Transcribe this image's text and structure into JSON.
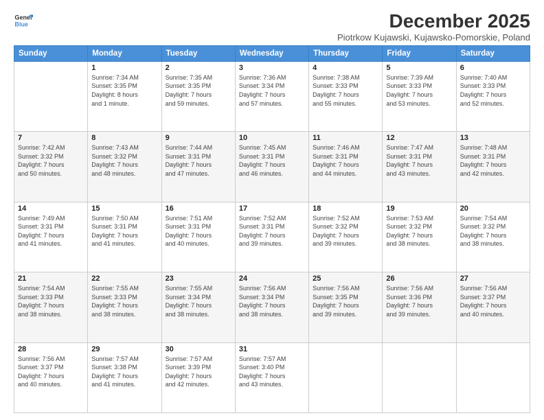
{
  "logo": {
    "line1": "General",
    "line2": "Blue"
  },
  "header": {
    "title": "December 2025",
    "subtitle": "Piotrkow Kujawski, Kujawsko-Pomorskie, Poland"
  },
  "weekdays": [
    "Sunday",
    "Monday",
    "Tuesday",
    "Wednesday",
    "Thursday",
    "Friday",
    "Saturday"
  ],
  "weeks": [
    [
      {
        "day": "",
        "info": ""
      },
      {
        "day": "1",
        "info": "Sunrise: 7:34 AM\nSunset: 3:35 PM\nDaylight: 8 hours\nand 1 minute."
      },
      {
        "day": "2",
        "info": "Sunrise: 7:35 AM\nSunset: 3:35 PM\nDaylight: 7 hours\nand 59 minutes."
      },
      {
        "day": "3",
        "info": "Sunrise: 7:36 AM\nSunset: 3:34 PM\nDaylight: 7 hours\nand 57 minutes."
      },
      {
        "day": "4",
        "info": "Sunrise: 7:38 AM\nSunset: 3:33 PM\nDaylight: 7 hours\nand 55 minutes."
      },
      {
        "day": "5",
        "info": "Sunrise: 7:39 AM\nSunset: 3:33 PM\nDaylight: 7 hours\nand 53 minutes."
      },
      {
        "day": "6",
        "info": "Sunrise: 7:40 AM\nSunset: 3:33 PM\nDaylight: 7 hours\nand 52 minutes."
      }
    ],
    [
      {
        "day": "7",
        "info": "Sunrise: 7:42 AM\nSunset: 3:32 PM\nDaylight: 7 hours\nand 50 minutes."
      },
      {
        "day": "8",
        "info": "Sunrise: 7:43 AM\nSunset: 3:32 PM\nDaylight: 7 hours\nand 48 minutes."
      },
      {
        "day": "9",
        "info": "Sunrise: 7:44 AM\nSunset: 3:31 PM\nDaylight: 7 hours\nand 47 minutes."
      },
      {
        "day": "10",
        "info": "Sunrise: 7:45 AM\nSunset: 3:31 PM\nDaylight: 7 hours\nand 46 minutes."
      },
      {
        "day": "11",
        "info": "Sunrise: 7:46 AM\nSunset: 3:31 PM\nDaylight: 7 hours\nand 44 minutes."
      },
      {
        "day": "12",
        "info": "Sunrise: 7:47 AM\nSunset: 3:31 PM\nDaylight: 7 hours\nand 43 minutes."
      },
      {
        "day": "13",
        "info": "Sunrise: 7:48 AM\nSunset: 3:31 PM\nDaylight: 7 hours\nand 42 minutes."
      }
    ],
    [
      {
        "day": "14",
        "info": "Sunrise: 7:49 AM\nSunset: 3:31 PM\nDaylight: 7 hours\nand 41 minutes."
      },
      {
        "day": "15",
        "info": "Sunrise: 7:50 AM\nSunset: 3:31 PM\nDaylight: 7 hours\nand 41 minutes."
      },
      {
        "day": "16",
        "info": "Sunrise: 7:51 AM\nSunset: 3:31 PM\nDaylight: 7 hours\nand 40 minutes."
      },
      {
        "day": "17",
        "info": "Sunrise: 7:52 AM\nSunset: 3:31 PM\nDaylight: 7 hours\nand 39 minutes."
      },
      {
        "day": "18",
        "info": "Sunrise: 7:52 AM\nSunset: 3:32 PM\nDaylight: 7 hours\nand 39 minutes."
      },
      {
        "day": "19",
        "info": "Sunrise: 7:53 AM\nSunset: 3:32 PM\nDaylight: 7 hours\nand 38 minutes."
      },
      {
        "day": "20",
        "info": "Sunrise: 7:54 AM\nSunset: 3:32 PM\nDaylight: 7 hours\nand 38 minutes."
      }
    ],
    [
      {
        "day": "21",
        "info": "Sunrise: 7:54 AM\nSunset: 3:33 PM\nDaylight: 7 hours\nand 38 minutes."
      },
      {
        "day": "22",
        "info": "Sunrise: 7:55 AM\nSunset: 3:33 PM\nDaylight: 7 hours\nand 38 minutes."
      },
      {
        "day": "23",
        "info": "Sunrise: 7:55 AM\nSunset: 3:34 PM\nDaylight: 7 hours\nand 38 minutes."
      },
      {
        "day": "24",
        "info": "Sunrise: 7:56 AM\nSunset: 3:34 PM\nDaylight: 7 hours\nand 38 minutes."
      },
      {
        "day": "25",
        "info": "Sunrise: 7:56 AM\nSunset: 3:35 PM\nDaylight: 7 hours\nand 39 minutes."
      },
      {
        "day": "26",
        "info": "Sunrise: 7:56 AM\nSunset: 3:36 PM\nDaylight: 7 hours\nand 39 minutes."
      },
      {
        "day": "27",
        "info": "Sunrise: 7:56 AM\nSunset: 3:37 PM\nDaylight: 7 hours\nand 40 minutes."
      }
    ],
    [
      {
        "day": "28",
        "info": "Sunrise: 7:56 AM\nSunset: 3:37 PM\nDaylight: 7 hours\nand 40 minutes."
      },
      {
        "day": "29",
        "info": "Sunrise: 7:57 AM\nSunset: 3:38 PM\nDaylight: 7 hours\nand 41 minutes."
      },
      {
        "day": "30",
        "info": "Sunrise: 7:57 AM\nSunset: 3:39 PM\nDaylight: 7 hours\nand 42 minutes."
      },
      {
        "day": "31",
        "info": "Sunrise: 7:57 AM\nSunset: 3:40 PM\nDaylight: 7 hours\nand 43 minutes."
      },
      {
        "day": "",
        "info": ""
      },
      {
        "day": "",
        "info": ""
      },
      {
        "day": "",
        "info": ""
      }
    ]
  ]
}
